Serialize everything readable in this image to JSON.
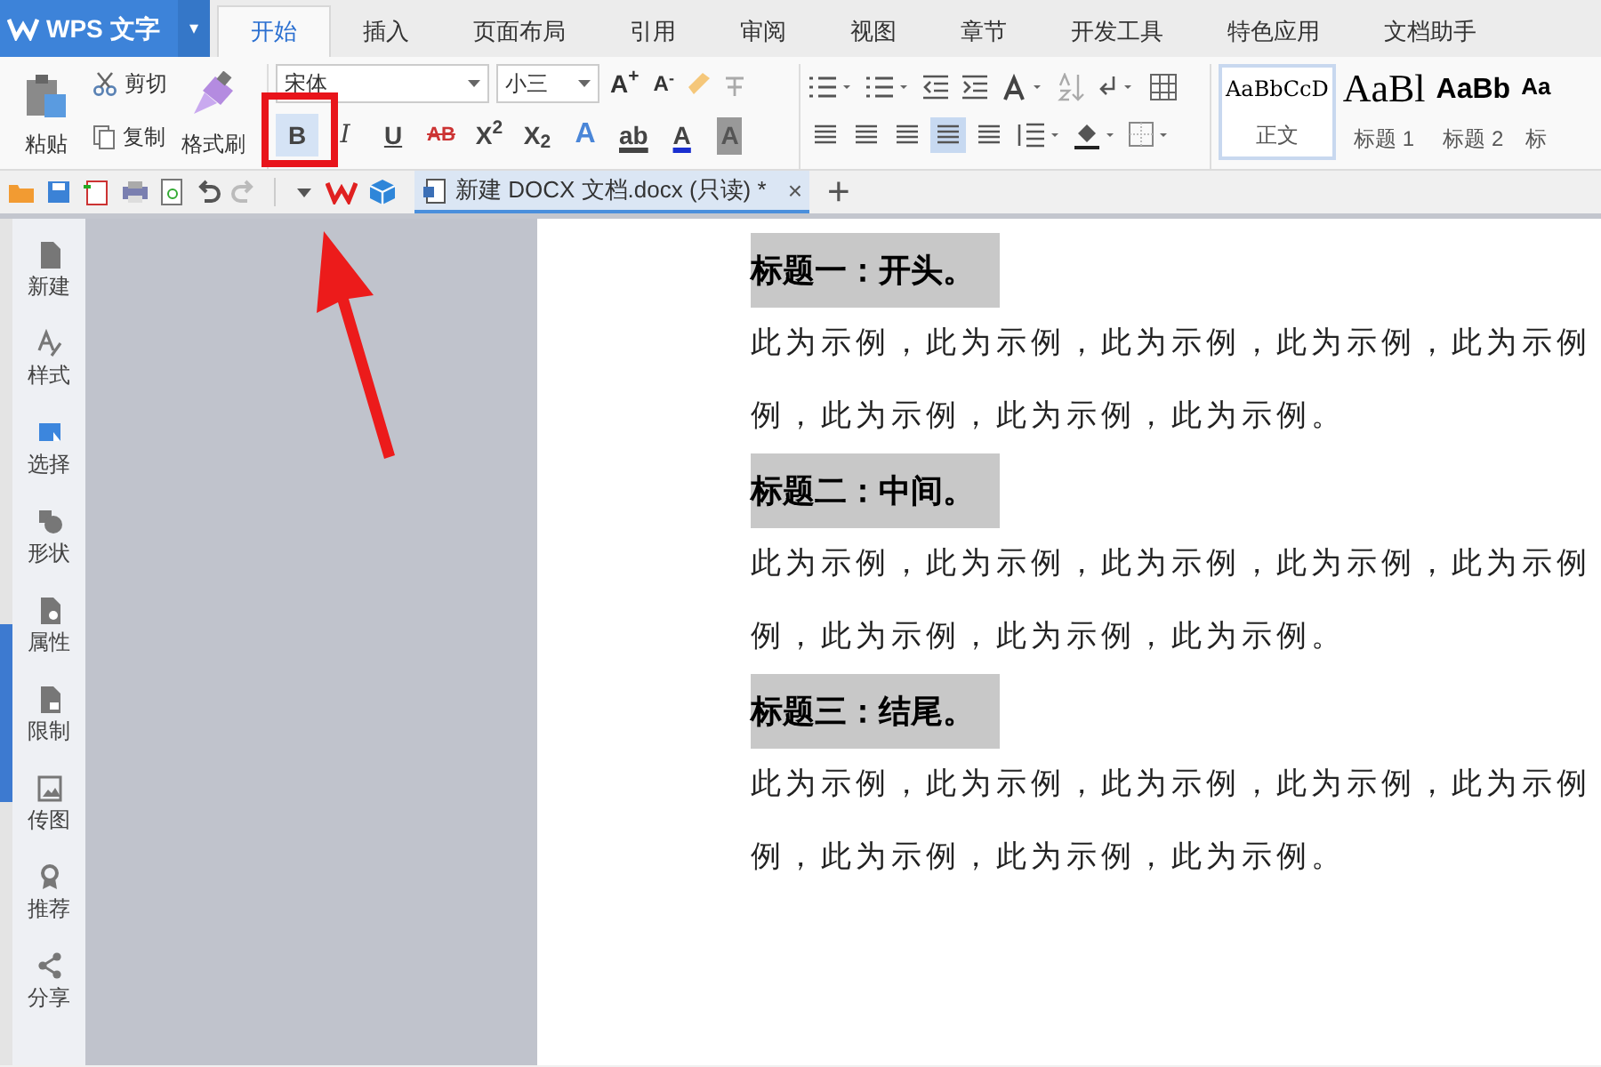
{
  "app_button": {
    "label": "WPS 文字",
    "caret": "▾"
  },
  "menu_tabs": [
    {
      "label": "开始",
      "selected": true
    },
    {
      "label": "插入",
      "selected": false
    },
    {
      "label": "页面布局",
      "selected": false
    },
    {
      "label": "引用",
      "selected": false
    },
    {
      "label": "审阅",
      "selected": false
    },
    {
      "label": "视图",
      "selected": false
    },
    {
      "label": "章节",
      "selected": false
    },
    {
      "label": "开发工具",
      "selected": false
    },
    {
      "label": "特色应用",
      "selected": false
    },
    {
      "label": "文档助手",
      "selected": false
    }
  ],
  "ribbon": {
    "paste": "粘贴",
    "cut": "剪切",
    "copy": "复制",
    "format_painter": "格式刷",
    "font_name": "宋体",
    "font_size": "小三",
    "grow_font": "A$^{+}$",
    "shrink_font": "A$^{-}$",
    "format_buttons": [
      {
        "kind": "bold",
        "label": "B",
        "selected": true
      },
      {
        "kind": "italic",
        "label": "I",
        "selected": false
      },
      {
        "kind": "underline",
        "label": "U",
        "selected": false
      },
      {
        "kind": "strike",
        "label": "AB",
        "selected": false
      },
      {
        "kind": "plain",
        "label": "X$^{2}$",
        "selected": false
      },
      {
        "kind": "plain",
        "label": "X$_{2}$",
        "selected": false
      },
      {
        "kind": "outline",
        "label": "A",
        "selected": false
      },
      {
        "kind": "highlight",
        "label": "ab",
        "selected": false
      },
      {
        "kind": "color",
        "label": "A",
        "selected": false
      },
      {
        "kind": "shade",
        "label": "A",
        "selected": false
      }
    ],
    "align_buttons": [
      {
        "selected": false
      },
      {
        "selected": false
      },
      {
        "selected": false
      },
      {
        "selected": true
      },
      {
        "selected": false
      }
    ],
    "styles": [
      {
        "preview": "AaBbCcD",
        "label": "正文",
        "kind": "normal",
        "selected": true
      },
      {
        "preview": "AaBl",
        "label": "标题 1",
        "kind": "h1",
        "selected": false
      },
      {
        "preview": "AaBb",
        "label": "标题 2",
        "kind": "h2",
        "selected": false
      },
      {
        "preview": "Aa",
        "label": "标",
        "kind": "h3",
        "selected": false
      }
    ]
  },
  "doc_tab": {
    "title": "新建 DOCX 文档.docx (只读) *",
    "close": "×",
    "new_tab": "+"
  },
  "sidebar": {
    "items": [
      {
        "label": "新建",
        "kind": "new"
      },
      {
        "label": "样式",
        "kind": "style"
      },
      {
        "label": "选择",
        "kind": "select"
      },
      {
        "label": "形状",
        "kind": "shape"
      },
      {
        "label": "属性",
        "kind": "props"
      },
      {
        "label": "限制",
        "kind": "lock"
      },
      {
        "label": "传图",
        "kind": "image"
      },
      {
        "label": "推荐",
        "kind": "award"
      },
      {
        "label": "分享",
        "kind": "share"
      }
    ]
  },
  "document": {
    "paragraphs": [
      {
        "kind": "heading",
        "text": "标题一：开头。"
      },
      {
        "kind": "body",
        "lines": [
          "此为示例，此为示例，此为示例，此为示例，此为示例",
          "例，此为示例，此为示例，此为示例。"
        ]
      },
      {
        "kind": "heading",
        "text": "标题二：中间。"
      },
      {
        "kind": "body",
        "lines": [
          "此为示例，此为示例，此为示例，此为示例，此为示例",
          "例，此为示例，此为示例，此为示例。"
        ]
      },
      {
        "kind": "heading",
        "text": "标题三：结尾。"
      },
      {
        "kind": "body",
        "lines": [
          "此为示例，此为示例，此为示例，此为示例，此为示例",
          "例，此为示例，此为示例，此为示例。"
        ]
      }
    ]
  }
}
